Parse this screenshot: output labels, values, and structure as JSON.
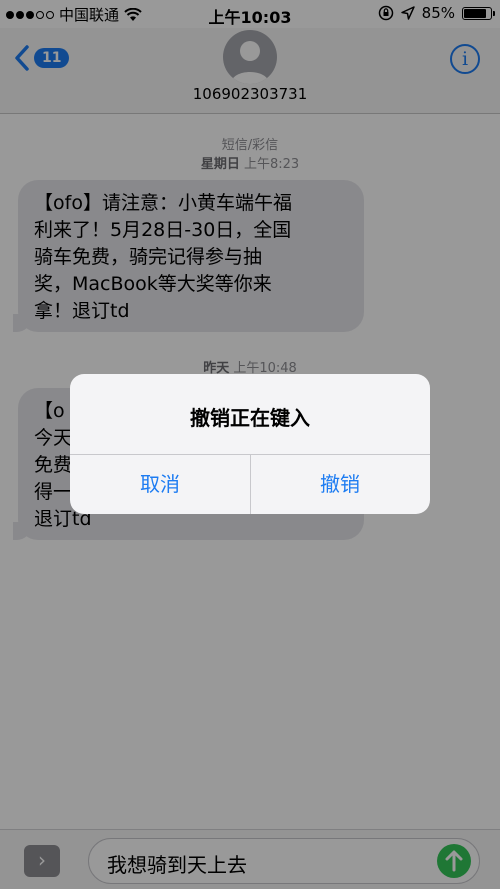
{
  "status_bar": {
    "carrier": "中国联通",
    "time": "上午10:03",
    "battery_percent": "85%",
    "battery_level": 0.85
  },
  "nav": {
    "back_badge": "11",
    "contact": "106902303731",
    "accent_color": "#1d7cf2"
  },
  "thread": {
    "header1_type": "短信/彩信",
    "header1_day": "星期日",
    "header1_time": "上午8:23",
    "msg1_lines": [
      "【ofo】请注意：小黄车端午福",
      "利来了！5月28日-30日，全国",
      "骑车免费，骑完记得参与抽",
      "奖，MacBook等大奖等你来",
      "拿！退订td"
    ],
    "header2_day": "昨天",
    "header2_time": "上午10:48",
    "msg2_lines": [
      "【o",
      "今天",
      "免费",
      "得一",
      "退订td"
    ]
  },
  "input": {
    "text": "我想骑到天上去"
  },
  "alert": {
    "title": "撤销正在键入",
    "cancel_label": "取消",
    "undo_label": "撤销"
  },
  "icons": [
    "back-chevron-icon",
    "avatar-silhouette-icon",
    "info-icon",
    "wifi-icon",
    "location-arrow-icon",
    "orientation-lock-icon",
    "battery-icon",
    "expand-arrow-icon",
    "send-arrow-icon"
  ]
}
